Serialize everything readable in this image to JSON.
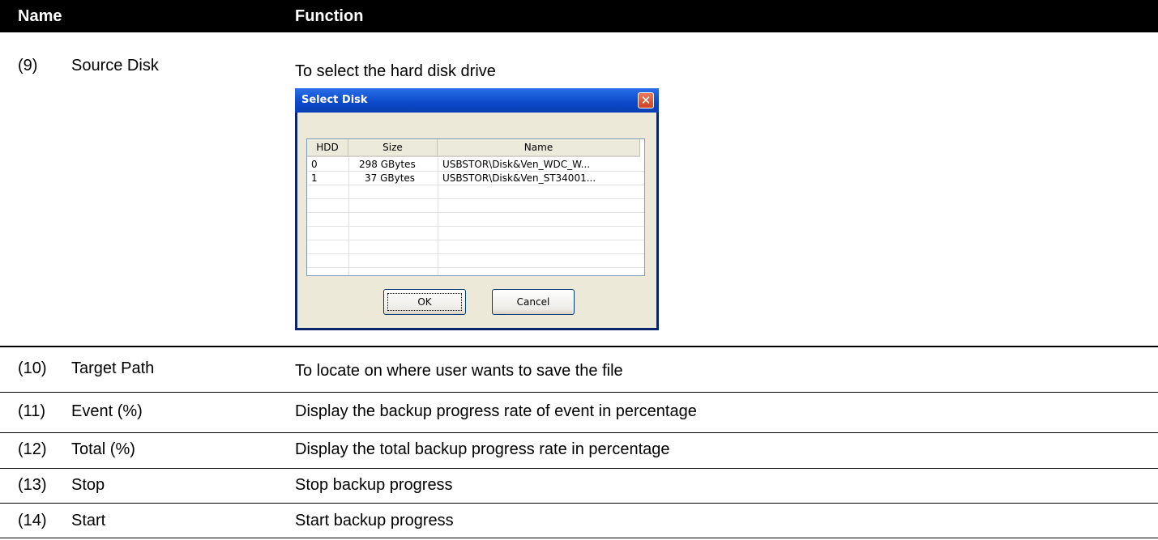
{
  "header": {
    "col_name": "Name",
    "col_function": "Function"
  },
  "rows": [
    {
      "num": "(9)",
      "name": "Source Disk",
      "func": "To select the hard disk drive"
    },
    {
      "num": "(10)",
      "name": "Target Path",
      "func": "To locate on where user wants to save the file"
    },
    {
      "num": "(11)",
      "name": "Event (%)",
      "func": "Display the backup progress rate of event in percentage"
    },
    {
      "num": "(12)",
      "name": "Total (%)",
      "func": "Display the total backup progress rate in percentage"
    },
    {
      "num": "(13)",
      "name": "Stop",
      "func": "Stop backup progress"
    },
    {
      "num": "(14)",
      "name": "Start",
      "func": "Start backup progress"
    }
  ],
  "dialog": {
    "title": "Select Disk",
    "close_glyph": "✕",
    "columns": [
      "HDD",
      "Size",
      "Name"
    ],
    "disks": [
      {
        "hdd": "0",
        "size": "298 GBytes",
        "name": "USBSTOR\\Disk&Ven_WDC_W..."
      },
      {
        "hdd": "1",
        "size": "37 GBytes",
        "name": "USBSTOR\\Disk&Ven_ST34001..."
      }
    ],
    "ok_label": "OK",
    "cancel_label": "Cancel"
  }
}
